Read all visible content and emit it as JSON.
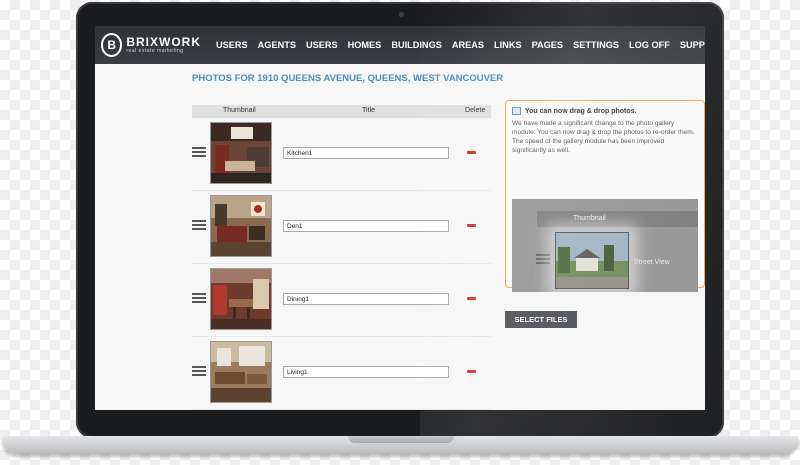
{
  "brand": {
    "name": "BRIXWORK",
    "tagline": "real estate marketing",
    "mark": "B"
  },
  "nav": [
    "USERS",
    "AGENTS",
    "USERS",
    "HOMES",
    "BUILDINGS",
    "AREAS",
    "LINKS",
    "PAGES",
    "SETTINGS",
    "LOG OFF",
    "SUPPORT"
  ],
  "page_title": "PHOTOS FOR 1910 QUEENS AVENUE, QUEENS, WEST VANCOUVER",
  "table": {
    "headers": {
      "thumbnail": "Thumbnail",
      "title": "Title",
      "delete": "Delete"
    },
    "rows": [
      {
        "title": "Kitchen1"
      },
      {
        "title": "Den1"
      },
      {
        "title": "Dining1"
      },
      {
        "title": "Living1"
      }
    ]
  },
  "info": {
    "heading": "You can now drag & drop photos.",
    "body": "We have made a significant change to the photo gallery module. You can now drag & drop the photos to re-order them. The speed of the gallery module has been improved significantly as well.",
    "demo_header": "Thumbnail",
    "demo_label": "Street View"
  },
  "select_files": "SELECT FILES",
  "colors": {
    "title_blue": "#4d8dbb",
    "info_border": "#f0a94c",
    "delete_red": "#d5302b"
  }
}
